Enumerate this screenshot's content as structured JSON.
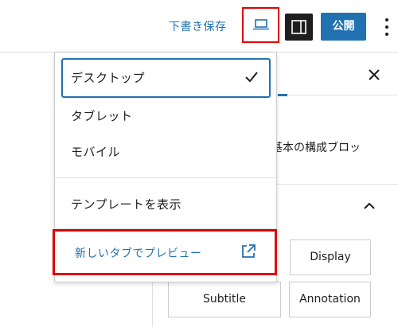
{
  "toolbar": {
    "draft_label": "下書き保存",
    "publish_label": "公開"
  },
  "sidebar": {
    "block_description": "り基本の構成ブロッ",
    "style_buttons": [
      "Display",
      "Subtitle",
      "Annotation"
    ]
  },
  "preview_menu": {
    "items": [
      {
        "label": "デスクトップ",
        "selected": true
      },
      {
        "label": "タブレット",
        "selected": false
      },
      {
        "label": "モバイル",
        "selected": false
      }
    ],
    "show_template_label": "テンプレートを表示",
    "preview_new_tab_label": "新しいタブでプレビュー"
  },
  "colors": {
    "accent": "#2271b1",
    "highlight_border": "#e00000",
    "dark": "#1e1e1e"
  },
  "icons": {
    "device_preview": "laptop-icon",
    "settings": "sidebar-toggle-icon",
    "more": "more-vertical-icon",
    "close": "close-icon",
    "selected": "check-icon",
    "collapse": "chevron-up-icon",
    "new_tab": "external-link-icon"
  }
}
